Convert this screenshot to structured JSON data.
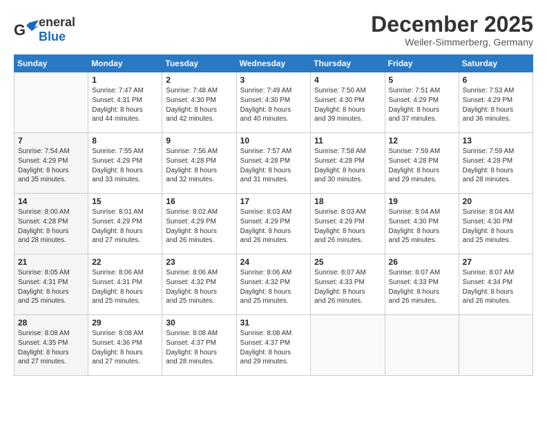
{
  "header": {
    "logo_general": "General",
    "logo_blue": "Blue",
    "month_title": "December 2025",
    "location": "Weiler-Simmerberg, Germany"
  },
  "days_of_week": [
    "Sunday",
    "Monday",
    "Tuesday",
    "Wednesday",
    "Thursday",
    "Friday",
    "Saturday"
  ],
  "weeks": [
    [
      {
        "day": "",
        "info": ""
      },
      {
        "day": "1",
        "info": "Sunrise: 7:47 AM\nSunset: 4:31 PM\nDaylight: 8 hours\nand 44 minutes."
      },
      {
        "day": "2",
        "info": "Sunrise: 7:48 AM\nSunset: 4:30 PM\nDaylight: 8 hours\nand 42 minutes."
      },
      {
        "day": "3",
        "info": "Sunrise: 7:49 AM\nSunset: 4:30 PM\nDaylight: 8 hours\nand 40 minutes."
      },
      {
        "day": "4",
        "info": "Sunrise: 7:50 AM\nSunset: 4:30 PM\nDaylight: 8 hours\nand 39 minutes."
      },
      {
        "day": "5",
        "info": "Sunrise: 7:51 AM\nSunset: 4:29 PM\nDaylight: 8 hours\nand 37 minutes."
      },
      {
        "day": "6",
        "info": "Sunrise: 7:53 AM\nSunset: 4:29 PM\nDaylight: 8 hours\nand 36 minutes."
      }
    ],
    [
      {
        "day": "7",
        "info": "Sunrise: 7:54 AM\nSunset: 4:29 PM\nDaylight: 8 hours\nand 35 minutes."
      },
      {
        "day": "8",
        "info": "Sunrise: 7:55 AM\nSunset: 4:29 PM\nDaylight: 8 hours\nand 33 minutes."
      },
      {
        "day": "9",
        "info": "Sunrise: 7:56 AM\nSunset: 4:28 PM\nDaylight: 8 hours\nand 32 minutes."
      },
      {
        "day": "10",
        "info": "Sunrise: 7:57 AM\nSunset: 4:28 PM\nDaylight: 8 hours\nand 31 minutes."
      },
      {
        "day": "11",
        "info": "Sunrise: 7:58 AM\nSunset: 4:28 PM\nDaylight: 8 hours\nand 30 minutes."
      },
      {
        "day": "12",
        "info": "Sunrise: 7:59 AM\nSunset: 4:28 PM\nDaylight: 8 hours\nand 29 minutes."
      },
      {
        "day": "13",
        "info": "Sunrise: 7:59 AM\nSunset: 4:28 PM\nDaylight: 8 hours\nand 28 minutes."
      }
    ],
    [
      {
        "day": "14",
        "info": "Sunrise: 8:00 AM\nSunset: 4:28 PM\nDaylight: 8 hours\nand 28 minutes."
      },
      {
        "day": "15",
        "info": "Sunrise: 8:01 AM\nSunset: 4:29 PM\nDaylight: 8 hours\nand 27 minutes."
      },
      {
        "day": "16",
        "info": "Sunrise: 8:02 AM\nSunset: 4:29 PM\nDaylight: 8 hours\nand 26 minutes."
      },
      {
        "day": "17",
        "info": "Sunrise: 8:03 AM\nSunset: 4:29 PM\nDaylight: 8 hours\nand 26 minutes."
      },
      {
        "day": "18",
        "info": "Sunrise: 8:03 AM\nSunset: 4:29 PM\nDaylight: 8 hours\nand 26 minutes."
      },
      {
        "day": "19",
        "info": "Sunrise: 8:04 AM\nSunset: 4:30 PM\nDaylight: 8 hours\nand 25 minutes."
      },
      {
        "day": "20",
        "info": "Sunrise: 8:04 AM\nSunset: 4:30 PM\nDaylight: 8 hours\nand 25 minutes."
      }
    ],
    [
      {
        "day": "21",
        "info": "Sunrise: 8:05 AM\nSunset: 4:31 PM\nDaylight: 8 hours\nand 25 minutes."
      },
      {
        "day": "22",
        "info": "Sunrise: 8:06 AM\nSunset: 4:31 PM\nDaylight: 8 hours\nand 25 minutes."
      },
      {
        "day": "23",
        "info": "Sunrise: 8:06 AM\nSunset: 4:32 PM\nDaylight: 8 hours\nand 25 minutes."
      },
      {
        "day": "24",
        "info": "Sunrise: 8:06 AM\nSunset: 4:32 PM\nDaylight: 8 hours\nand 25 minutes."
      },
      {
        "day": "25",
        "info": "Sunrise: 8:07 AM\nSunset: 4:33 PM\nDaylight: 8 hours\nand 26 minutes."
      },
      {
        "day": "26",
        "info": "Sunrise: 8:07 AM\nSunset: 4:33 PM\nDaylight: 8 hours\nand 26 minutes."
      },
      {
        "day": "27",
        "info": "Sunrise: 8:07 AM\nSunset: 4:34 PM\nDaylight: 8 hours\nand 26 minutes."
      }
    ],
    [
      {
        "day": "28",
        "info": "Sunrise: 8:08 AM\nSunset: 4:35 PM\nDaylight: 8 hours\nand 27 minutes."
      },
      {
        "day": "29",
        "info": "Sunrise: 8:08 AM\nSunset: 4:36 PM\nDaylight: 8 hours\nand 27 minutes."
      },
      {
        "day": "30",
        "info": "Sunrise: 8:08 AM\nSunset: 4:37 PM\nDaylight: 8 hours\nand 28 minutes."
      },
      {
        "day": "31",
        "info": "Sunrise: 8:08 AM\nSunset: 4:37 PM\nDaylight: 8 hours\nand 29 minutes."
      },
      {
        "day": "",
        "info": ""
      },
      {
        "day": "",
        "info": ""
      },
      {
        "day": "",
        "info": ""
      }
    ]
  ]
}
